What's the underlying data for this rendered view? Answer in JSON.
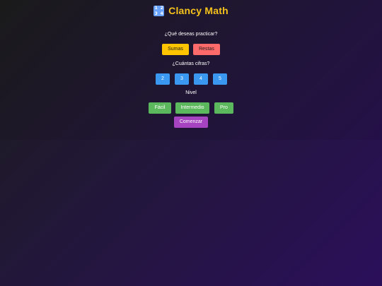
{
  "app": {
    "title": "Clancy Math",
    "icon_digits": [
      "1",
      "2",
      "3",
      "4"
    ]
  },
  "operation": {
    "question": "¿Qué deseas practicar?",
    "options": [
      "Sumas",
      "Restas"
    ]
  },
  "digits": {
    "question": "¿Cuántas cifras?",
    "options": [
      "2",
      "3",
      "4",
      "5"
    ]
  },
  "level": {
    "question": "Nivel",
    "options": [
      "Fácil",
      "Intermedio",
      "Pro"
    ]
  },
  "start": {
    "label": "Comenzar"
  },
  "colors": {
    "title": "#f6c21c",
    "sumas": "#ffc400",
    "restas": "#ff6b6b",
    "digits": "#3b98f0",
    "level": "#5cb85c",
    "start": "#a543c1"
  }
}
